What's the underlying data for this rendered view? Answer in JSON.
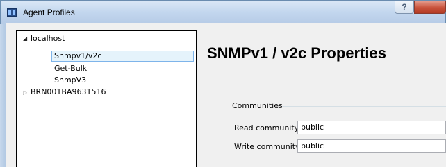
{
  "window": {
    "title": "Agent Profiles",
    "help_label": "?"
  },
  "tree": {
    "nodes": [
      {
        "label": "localhost",
        "expanded": true,
        "toggle": "◢"
      },
      {
        "label": "Snmpv1/v2c",
        "selected": true
      },
      {
        "label": "Get-Bulk"
      },
      {
        "label": "SnmpV3"
      },
      {
        "label": "BRN001BA9631516",
        "expanded": false,
        "toggle": "▷"
      }
    ]
  },
  "panel": {
    "heading": "SNMPv1 / v2c Properties",
    "group_title": "Communities",
    "fields": [
      {
        "label": "Read community",
        "value": "public"
      },
      {
        "label": "Write community",
        "value": "public"
      }
    ]
  },
  "colors": {
    "title_bar": "#c2d6ee",
    "selection_bg": "#e5f3fb",
    "selection_border": "#7eb4ea",
    "close_button": "#c9533c"
  }
}
